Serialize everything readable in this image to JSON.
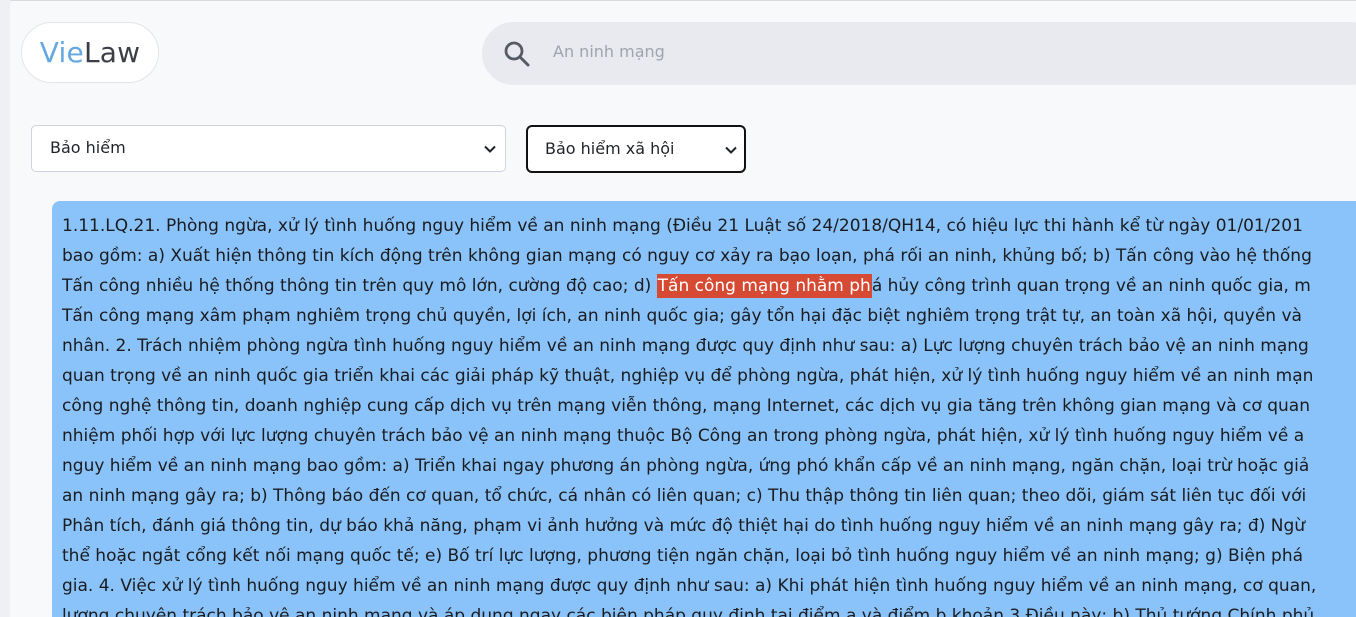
{
  "app": {
    "logo_part1": "Vie",
    "logo_part2": "Law"
  },
  "search": {
    "placeholder": "An ninh mạng"
  },
  "filters": {
    "category_selected": "Bảo hiểm",
    "subcategory_selected": "Bảo hiểm xã hội"
  },
  "content": {
    "line1": "1.11.LQ.21. Phòng ngừa, xử lý tình huống nguy hiểm về an ninh mạng (Điều 21 Luật số 24/2018/QH14, có hiệu lực thi hành kể từ ngày 01/01/201",
    "line2": "bao gồm: a) Xuất hiện thông tin kích động trên không gian mạng có nguy cơ xảy ra bạo loạn, phá rối an ninh, khủng bố; b) Tấn công vào hệ thống",
    "line3_before": "Tấn công nhiều hệ thống thông tin trên quy mô lớn, cường độ cao; d) ",
    "line3_highlight": "Tấn công mạng nhằm ph",
    "line3_after": "á hủy công trình quan trọng về an ninh quốc gia, m",
    "line4": "Tấn công mạng xâm phạm nghiêm trọng chủ quyền, lợi ích, an ninh quốc gia; gây tổn hại đặc biệt nghiêm trọng trật tự, an toàn xã hội, quyền và",
    "line5": "nhân. 2. Trách nhiệm phòng ngừa tình huống nguy hiểm về an ninh mạng được quy định như sau: a) Lực lượng chuyên trách bảo vệ an ninh mạng",
    "line6": "quan trọng về an ninh quốc gia triển khai các giải pháp kỹ thuật, nghiệp vụ để phòng ngừa, phát hiện, xử lý tình huống nguy hiểm về an ninh mạn",
    "line7": "công nghệ thông tin, doanh nghiệp cung cấp dịch vụ trên mạng viễn thông, mạng Internet, các dịch vụ gia tăng trên không gian mạng và cơ quan",
    "line8": "nhiệm phối hợp với lực lượng chuyên trách bảo vệ an ninh mạng thuộc Bộ Công an trong phòng ngừa, phát hiện, xử lý tình huống nguy hiểm về a",
    "line9": "nguy hiểm về an ninh mạng bao gồm: a) Triển khai ngay phương án phòng ngừa, ứng phó khẩn cấp về an ninh mạng, ngăn chặn, loại trừ hoặc giả",
    "line10": "an ninh mạng gây ra; b) Thông báo đến cơ quan, tổ chức, cá nhân có liên quan; c) Thu thập thông tin liên quan; theo dõi, giám sát liên tục đối với",
    "line11": "Phân tích, đánh giá thông tin, dự báo khả năng, phạm vi ảnh hưởng và mức độ thiệt hại do tình huống nguy hiểm về an ninh mạng gây ra; đ) Ngừ",
    "line12": "thể hoặc ngắt cổng kết nối mạng quốc tế; e) Bố trí lực lượng, phương tiện ngăn chặn, loại bỏ tình huống nguy hiểm về an ninh mạng; g) Biện phá",
    "line13": "gia. 4. Việc xử lý tình huống nguy hiểm về an ninh mạng được quy định như sau: a) Khi phát hiện tình huống nguy hiểm về an ninh mạng, cơ quan,",
    "line14": "lượng chuyên trách bảo vệ an ninh mạng và áp dụng ngay các biện pháp quy định tại điểm a và điểm b khoản 3 Điều này; b) Thủ tướng Chính phủ"
  }
}
